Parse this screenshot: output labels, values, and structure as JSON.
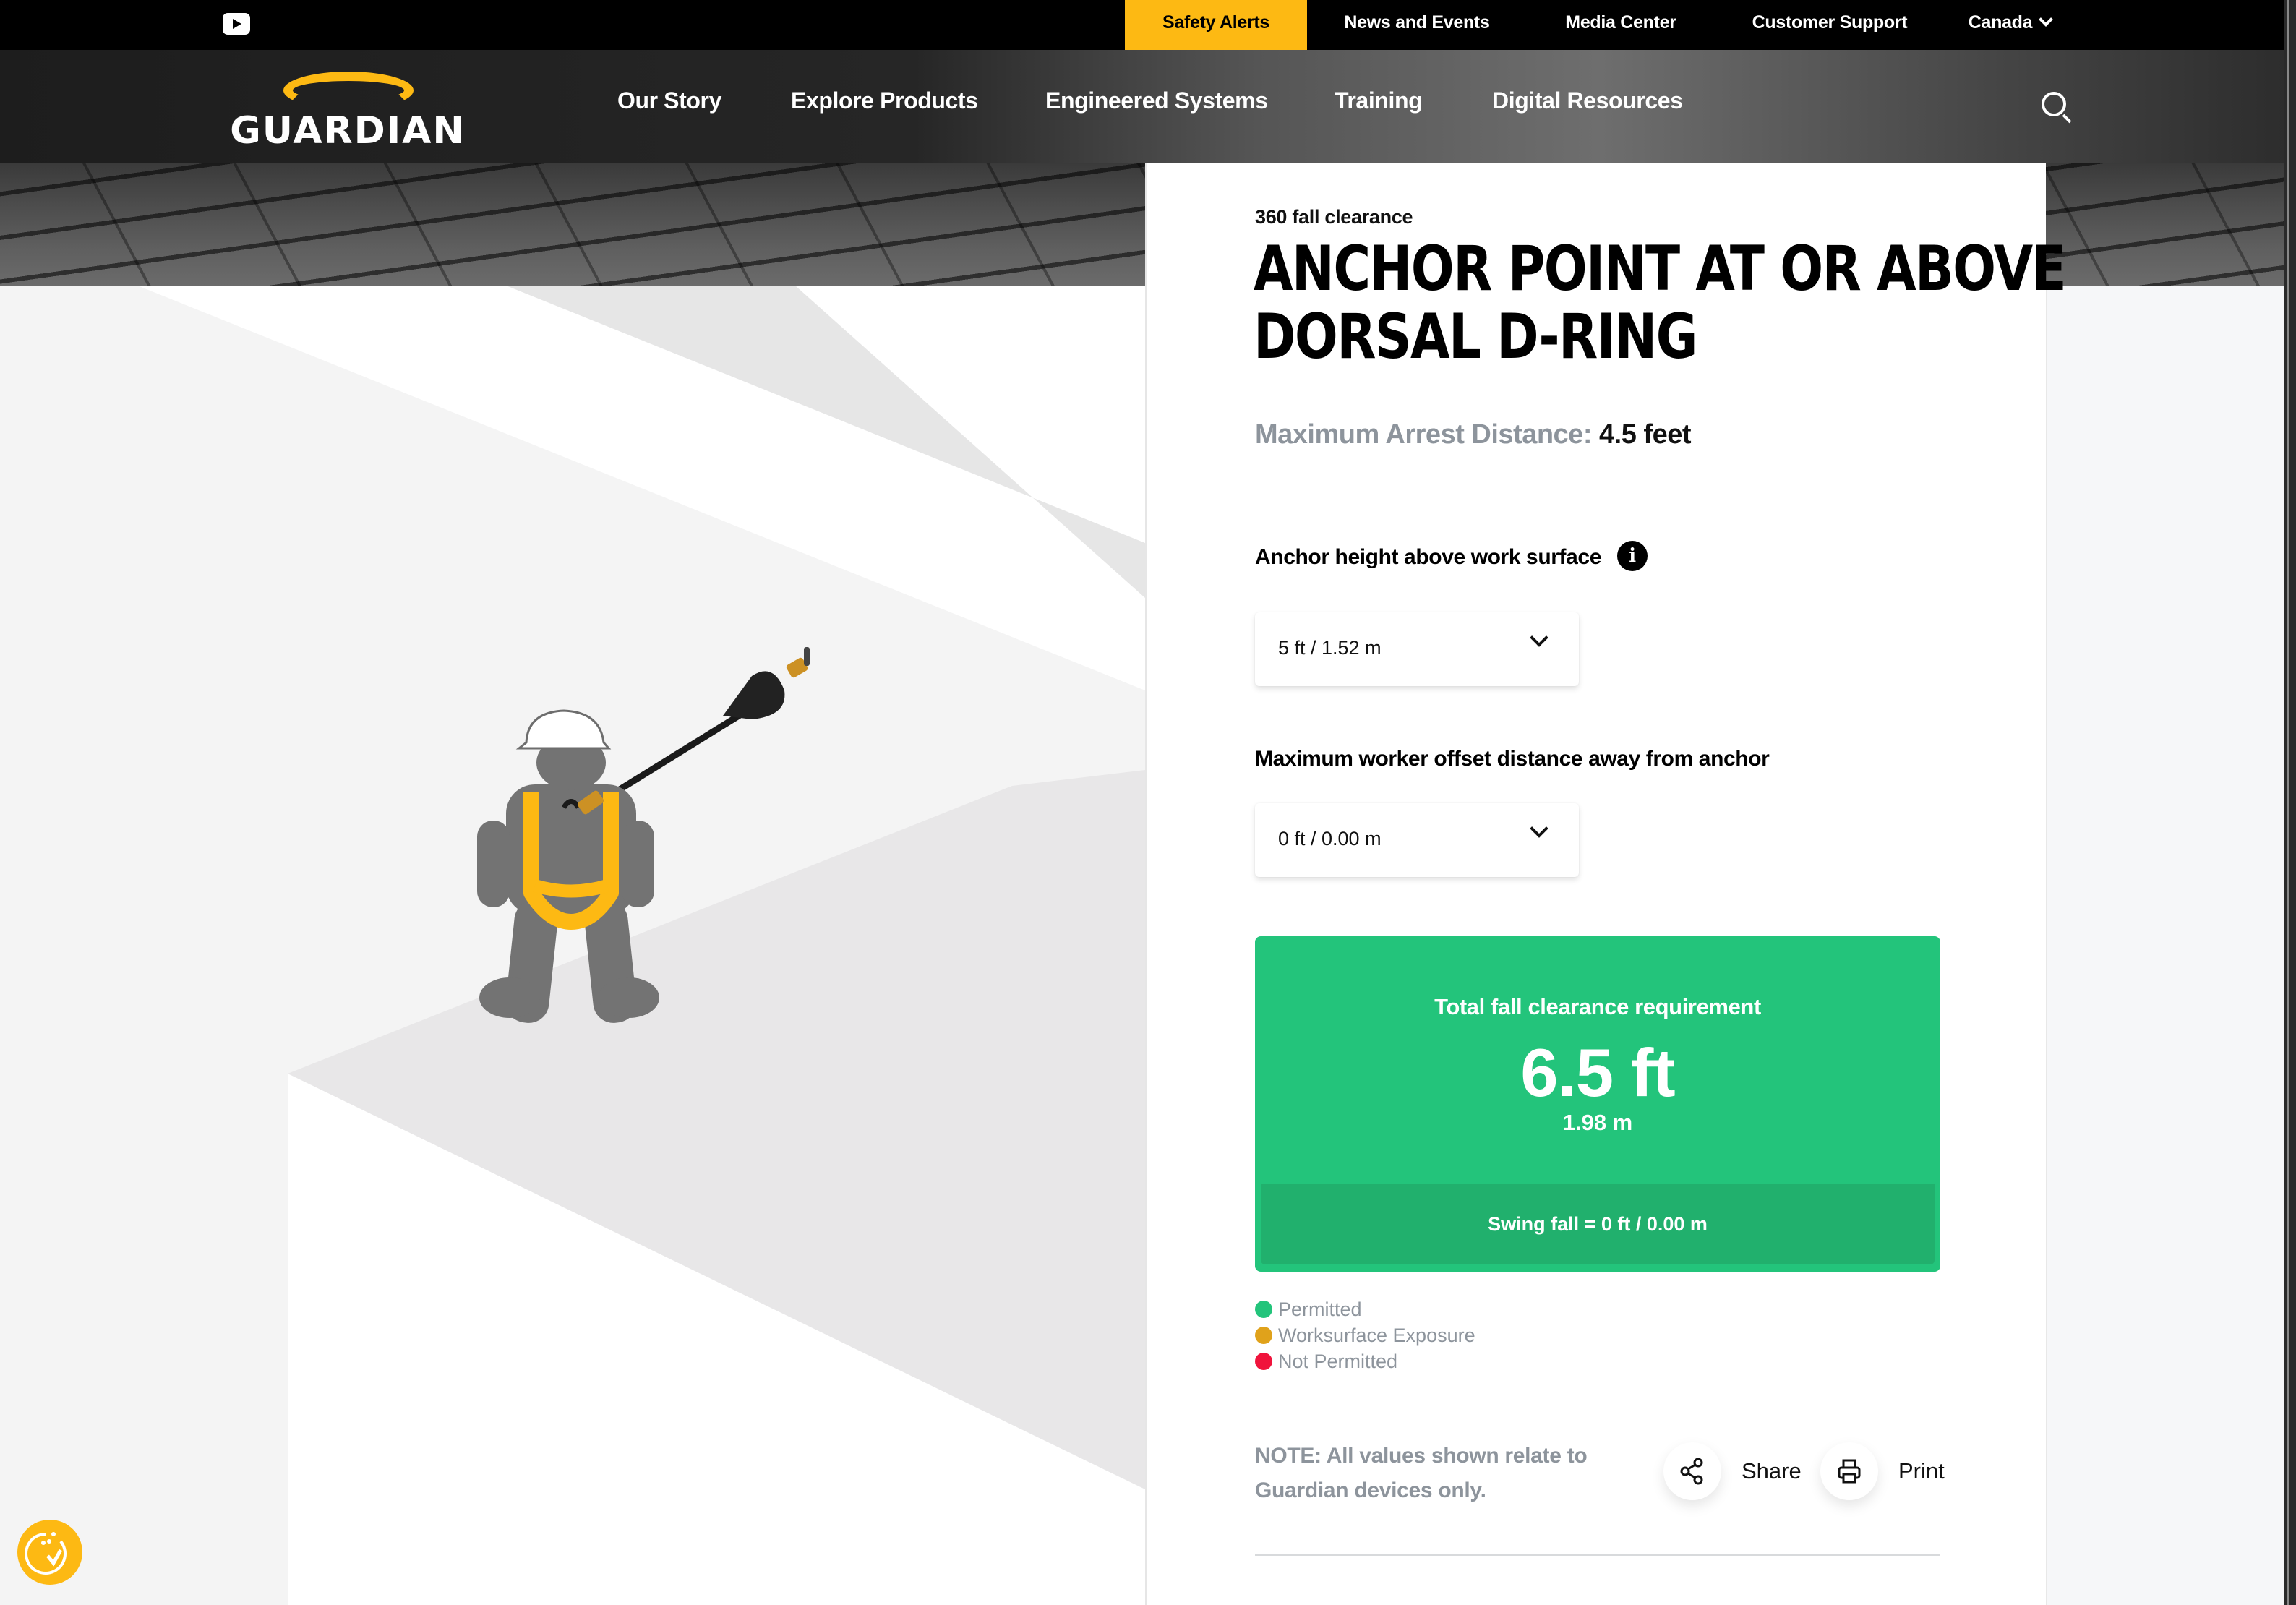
{
  "utility_bar": {
    "links": [
      {
        "label": "Safety Alerts",
        "active": true
      },
      {
        "label": "News and Events"
      },
      {
        "label": "Media Center"
      },
      {
        "label": "Customer Support"
      }
    ],
    "region": "Canada",
    "social_icon": "youtube-icon"
  },
  "brand": {
    "name": "GUARDIAN",
    "accent": "#fdb913"
  },
  "nav": {
    "items": [
      "Our Story",
      "Explore Products",
      "Engineered Systems",
      "Training",
      "Digital Resources"
    ],
    "search_icon": "search-icon"
  },
  "calculator": {
    "eyebrow": "360 fall clearance",
    "title_lines": [
      "ANCHOR POINT AT OR ABOVE",
      "DORSAL D-RING"
    ],
    "arrest_label": "Maximum Arrest Distance:",
    "arrest_value": "4.5 feet",
    "anchor_height": {
      "label": "Anchor height above work surface",
      "value": "5 ft / 1.52 m"
    },
    "offset": {
      "label": "Maximum worker offset distance away from anchor",
      "value": "0 ft / 0.00 m"
    },
    "result": {
      "label": "Total fall clearance requirement",
      "feet": "6.5 ft",
      "meters": "1.98 m",
      "swing_fall": "Swing fall = 0 ft / 0.00 m",
      "color": "#23c47b"
    },
    "legend": [
      {
        "label": "Permitted",
        "color": "#23c47b"
      },
      {
        "label": "Worksurface Exposure",
        "color": "#e0a21b"
      },
      {
        "label": "Not Permitted",
        "color": "#f0143c"
      }
    ],
    "note": "NOTE: All values shown relate to Guardian devices only.",
    "share_label": "Share",
    "print_label": "Print"
  },
  "cookie_badge": {
    "icon": "cookie-consent-icon"
  }
}
